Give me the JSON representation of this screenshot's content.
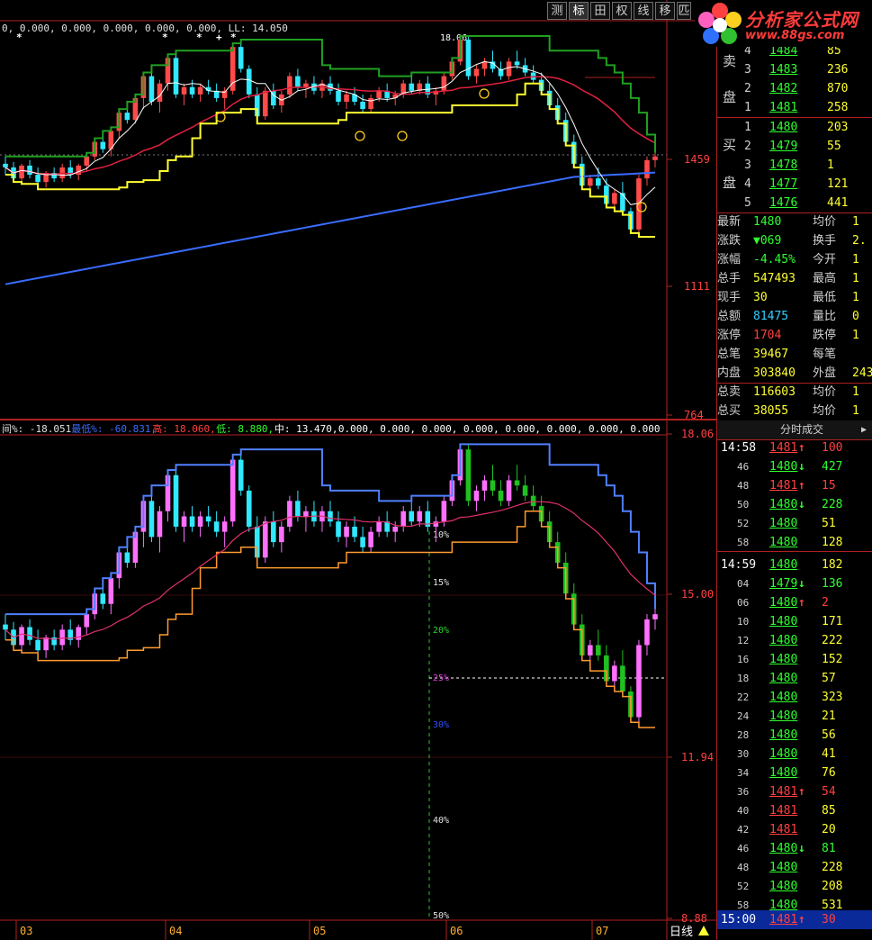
{
  "toolbar": {
    "buttons": [
      "测",
      "标",
      "田",
      "权",
      "线",
      "移",
      "匹"
    ]
  },
  "logo": {
    "name": "分析家公式网",
    "url": "www.88gs.com"
  },
  "colors": {
    "background": "#000000",
    "grid_red": "#b02020",
    "up_candle": "#ff4a4a",
    "down_candle": "#30e8ff",
    "ma_blue": "#3a6cff",
    "ma_red": "#e02040",
    "ma_green": "#20a020",
    "line_yellow": "#ffff30",
    "line_white": "#ffffff",
    "lower_magenta": "#ff70ff",
    "lower_green": "#20c020",
    "lower_orange": "#ff9a30"
  },
  "upper_legend": {
    "values": "0, 0.000, 0.000, 0.000, 0.000, 0.000, LL: 14.050"
  },
  "upper_price_labels": [
    "1459",
    "1111",
    "764",
    "18.06"
  ],
  "lower_legend": {
    "label_prefix": "间%: -18.051",
    "label_min": "最低%: -60.831,",
    "label_high": "高: 18.060,",
    "label_low": "低: 8.880,",
    "label_mid": "中: 13.470,",
    "label_rest": "0.000, 0.000, 0.000, 0.000, 0.000, 0.000, 0.000, 0.000"
  },
  "lower_price_labels": [
    "18.06",
    "15.00",
    "11.94",
    "8.88"
  ],
  "pct_labels": [
    "10%",
    "15%",
    "20%",
    "25%",
    "30%",
    "40%",
    "50%"
  ],
  "peak_label": "18.06",
  "x_labels": [
    "03",
    "04",
    "05",
    "06",
    "07"
  ],
  "period_label": "日线",
  "order_book": {
    "sell_title": "卖盘",
    "buy_title": "买盘",
    "sell": [
      {
        "level": "4",
        "price": "1484",
        "vol": "85"
      },
      {
        "level": "3",
        "price": "1483",
        "vol": "236"
      },
      {
        "level": "2",
        "price": "1482",
        "vol": "870"
      },
      {
        "level": "1",
        "price": "1481",
        "vol": "258"
      }
    ],
    "buy": [
      {
        "level": "1",
        "price": "1480",
        "vol": "203"
      },
      {
        "level": "2",
        "price": "1479",
        "vol": "55"
      },
      {
        "level": "3",
        "price": "1478",
        "vol": "1"
      },
      {
        "level": "4",
        "price": "1477",
        "vol": "121"
      },
      {
        "level": "5",
        "price": "1476",
        "vol": "441"
      }
    ]
  },
  "stats": [
    {
      "l1": "最新",
      "v1": "1480",
      "l2": "均价",
      "v2": "1"
    },
    {
      "l1": "涨跌",
      "v1": "▼069",
      "l2": "换手",
      "v2": "2."
    },
    {
      "l1": "涨幅",
      "v1": "-4.45%",
      "l2": "今开",
      "v2": "1"
    },
    {
      "l1": "总手",
      "v1": "547493",
      "l2": "最高",
      "v2": "1"
    },
    {
      "l1": "现手",
      "v1": "30",
      "l2": "最低",
      "v2": "1"
    },
    {
      "l1": "总额",
      "v1": "81475",
      "l2": "量比",
      "v2": "0"
    },
    {
      "l1": "涨停",
      "v1": "1704",
      "l2": "跌停",
      "v2": "1"
    },
    {
      "l1": "总笔",
      "v1": "39467",
      "l2": "每笔",
      "v2": ""
    },
    {
      "l1": "内盘",
      "v1": "303840",
      "l2": "外盘",
      "v2": "243"
    },
    {
      "l1": "总卖",
      "v1": "116603",
      "l2": "均价",
      "v2": "1"
    },
    {
      "l1": "总买",
      "v1": "38055",
      "l2": "均价",
      "v2": "1"
    }
  ],
  "ticks_title": "分时成交",
  "ticks": [
    {
      "t": "14:58",
      "p": "1481",
      "d": "up",
      "v": "100"
    },
    {
      "t": "46",
      "p": "1480",
      "d": "down",
      "v": "427"
    },
    {
      "t": "48",
      "p": "1481",
      "d": "up",
      "v": "15"
    },
    {
      "t": "50",
      "p": "1480",
      "d": "down",
      "v": "228"
    },
    {
      "t": "52",
      "p": "1480",
      "d": "",
      "v": "51"
    },
    {
      "t": "58",
      "p": "1480",
      "d": "",
      "v": "128"
    },
    {
      "t": "14:59",
      "p": "1480",
      "d": "",
      "v": "182"
    },
    {
      "t": "04",
      "p": "1479",
      "d": "down",
      "v": "136"
    },
    {
      "t": "06",
      "p": "1480",
      "d": "up",
      "v": "2"
    },
    {
      "t": "10",
      "p": "1480",
      "d": "",
      "v": "171"
    },
    {
      "t": "12",
      "p": "1480",
      "d": "",
      "v": "222"
    },
    {
      "t": "16",
      "p": "1480",
      "d": "",
      "v": "152"
    },
    {
      "t": "18",
      "p": "1480",
      "d": "",
      "v": "57"
    },
    {
      "t": "22",
      "p": "1480",
      "d": "",
      "v": "323"
    },
    {
      "t": "24",
      "p": "1480",
      "d": "",
      "v": "21"
    },
    {
      "t": "28",
      "p": "1480",
      "d": "",
      "v": "56"
    },
    {
      "t": "30",
      "p": "1480",
      "d": "",
      "v": "41"
    },
    {
      "t": "34",
      "p": "1480",
      "d": "",
      "v": "76"
    },
    {
      "t": "36",
      "p": "1481",
      "d": "up",
      "v": "54"
    },
    {
      "t": "40",
      "p": "1481",
      "d": "",
      "v": "85"
    },
    {
      "t": "42",
      "p": "1481",
      "d": "",
      "v": "20"
    },
    {
      "t": "46",
      "p": "1480",
      "d": "down",
      "v": "81"
    },
    {
      "t": "48",
      "p": "1480",
      "d": "",
      "v": "228"
    },
    {
      "t": "52",
      "p": "1480",
      "d": "",
      "v": "208"
    },
    {
      "t": "58",
      "p": "1480",
      "d": "",
      "v": "531"
    },
    {
      "t": "15:00",
      "p": "1481",
      "d": "up",
      "v": "30"
    }
  ],
  "chart_data": {
    "type": "candlestick",
    "upper_ylim": [
      764,
      1800
    ],
    "lower_ylim": [
      8.88,
      18.06
    ],
    "candles": [
      [
        1450,
        1470,
        1420,
        1440
      ],
      [
        1440,
        1455,
        1400,
        1410
      ],
      [
        1410,
        1450,
        1395,
        1445
      ],
      [
        1445,
        1460,
        1410,
        1420
      ],
      [
        1420,
        1440,
        1380,
        1400
      ],
      [
        1400,
        1430,
        1385,
        1425
      ],
      [
        1425,
        1440,
        1400,
        1410
      ],
      [
        1410,
        1450,
        1400,
        1440
      ],
      [
        1440,
        1460,
        1410,
        1420
      ],
      [
        1420,
        1450,
        1405,
        1445
      ],
      [
        1445,
        1480,
        1430,
        1470
      ],
      [
        1470,
        1520,
        1460,
        1510
      ],
      [
        1510,
        1540,
        1480,
        1490
      ],
      [
        1490,
        1550,
        1470,
        1540
      ],
      [
        1540,
        1600,
        1520,
        1590
      ],
      [
        1590,
        1620,
        1560,
        1570
      ],
      [
        1570,
        1640,
        1560,
        1630
      ],
      [
        1630,
        1700,
        1600,
        1690
      ],
      [
        1690,
        1720,
        1610,
        1620
      ],
      [
        1620,
        1680,
        1590,
        1670
      ],
      [
        1670,
        1750,
        1650,
        1740
      ],
      [
        1740,
        1760,
        1630,
        1640
      ],
      [
        1640,
        1670,
        1610,
        1660
      ],
      [
        1660,
        1680,
        1630,
        1640
      ],
      [
        1640,
        1670,
        1620,
        1660
      ],
      [
        1660,
        1680,
        1640,
        1650
      ],
      [
        1650,
        1670,
        1620,
        1630
      ],
      [
        1630,
        1660,
        1600,
        1650
      ],
      [
        1650,
        1780,
        1640,
        1770
      ],
      [
        1770,
        1790,
        1700,
        1710
      ],
      [
        1710,
        1720,
        1630,
        1640
      ],
      [
        1640,
        1660,
        1560,
        1580
      ],
      [
        1580,
        1660,
        1570,
        1650
      ],
      [
        1650,
        1670,
        1600,
        1610
      ],
      [
        1610,
        1650,
        1590,
        1640
      ],
      [
        1640,
        1700,
        1630,
        1690
      ],
      [
        1690,
        1710,
        1650,
        1660
      ],
      [
        1660,
        1680,
        1630,
        1670
      ],
      [
        1670,
        1690,
        1640,
        1650
      ],
      [
        1650,
        1680,
        1630,
        1670
      ],
      [
        1670,
        1690,
        1640,
        1650
      ],
      [
        1650,
        1670,
        1610,
        1620
      ],
      [
        1620,
        1650,
        1600,
        1640
      ],
      [
        1640,
        1660,
        1610,
        1620
      ],
      [
        1620,
        1640,
        1590,
        1600
      ],
      [
        1600,
        1640,
        1590,
        1630
      ],
      [
        1630,
        1660,
        1620,
        1650
      ],
      [
        1650,
        1670,
        1620,
        1630
      ],
      [
        1630,
        1650,
        1610,
        1640
      ],
      [
        1640,
        1680,
        1630,
        1670
      ],
      [
        1670,
        1700,
        1640,
        1650
      ],
      [
        1650,
        1680,
        1640,
        1670
      ],
      [
        1670,
        1690,
        1630,
        1640
      ],
      [
        1640,
        1660,
        1610,
        1650
      ],
      [
        1650,
        1700,
        1640,
        1690
      ],
      [
        1690,
        1740,
        1680,
        1730
      ],
      [
        1730,
        1800,
        1720,
        1790
      ],
      [
        1790,
        1800,
        1680,
        1690
      ],
      [
        1690,
        1720,
        1670,
        1710
      ],
      [
        1710,
        1740,
        1690,
        1730
      ],
      [
        1730,
        1760,
        1700,
        1710
      ],
      [
        1710,
        1730,
        1680,
        1690
      ],
      [
        1690,
        1740,
        1680,
        1730
      ],
      [
        1730,
        1760,
        1710,
        1720
      ],
      [
        1720,
        1740,
        1690,
        1700
      ],
      [
        1700,
        1720,
        1670,
        1680
      ],
      [
        1680,
        1700,
        1640,
        1650
      ],
      [
        1650,
        1670,
        1600,
        1610
      ],
      [
        1610,
        1630,
        1560,
        1570
      ],
      [
        1570,
        1590,
        1500,
        1510
      ],
      [
        1510,
        1530,
        1440,
        1450
      ],
      [
        1450,
        1470,
        1380,
        1390
      ],
      [
        1390,
        1420,
        1360,
        1410
      ],
      [
        1410,
        1440,
        1380,
        1390
      ],
      [
        1390,
        1410,
        1330,
        1340
      ],
      [
        1340,
        1380,
        1320,
        1370
      ],
      [
        1370,
        1400,
        1310,
        1320
      ],
      [
        1320,
        1330,
        1260,
        1270
      ],
      [
        1270,
        1420,
        1250,
        1410
      ],
      [
        1410,
        1470,
        1390,
        1460
      ],
      [
        1460,
        1480,
        1440,
        1470
      ]
    ]
  }
}
